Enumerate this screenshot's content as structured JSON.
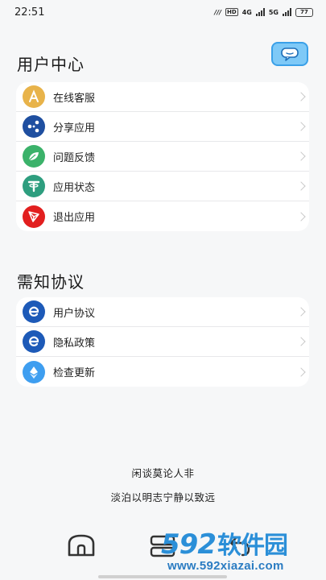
{
  "status_bar": {
    "time": "22:51",
    "hd": "HD",
    "network_1": "4G",
    "network_2": "5G",
    "battery": "77"
  },
  "user_center": {
    "title": "用户中心",
    "items": [
      {
        "label": "在线客服",
        "icon": "customer-service-icon",
        "color": "#e8b34a"
      },
      {
        "label": "分享应用",
        "icon": "share-icon",
        "color": "#1f4fa0"
      },
      {
        "label": "问题反馈",
        "icon": "leaf-feedback-icon",
        "color": "#3bb26a"
      },
      {
        "label": "应用状态",
        "icon": "tether-status-icon",
        "color": "#2e9e7f"
      },
      {
        "label": "退出应用",
        "icon": "exit-triangle-icon",
        "color": "#e21f1f"
      }
    ]
  },
  "agreements": {
    "title": "需知协议",
    "items": [
      {
        "label": "用户协议",
        "icon": "e-doc-icon",
        "color": "#1d5ab8"
      },
      {
        "label": "隐私政策",
        "icon": "e-doc-icon",
        "color": "#1d5ab8"
      },
      {
        "label": "检查更新",
        "icon": "diamond-update-icon",
        "color": "#3e9ef0"
      }
    ]
  },
  "quotes": {
    "line1": "闲谈莫论人非",
    "line2": "淡泊以明志宁静以致远"
  },
  "watermark": {
    "brand_number": "592",
    "brand_name": "软件园",
    "url": "www.592xiazai.com"
  },
  "colors": {
    "background": "#f6f7f8",
    "card": "#ffffff",
    "chat_button": "#7ec9f7"
  }
}
